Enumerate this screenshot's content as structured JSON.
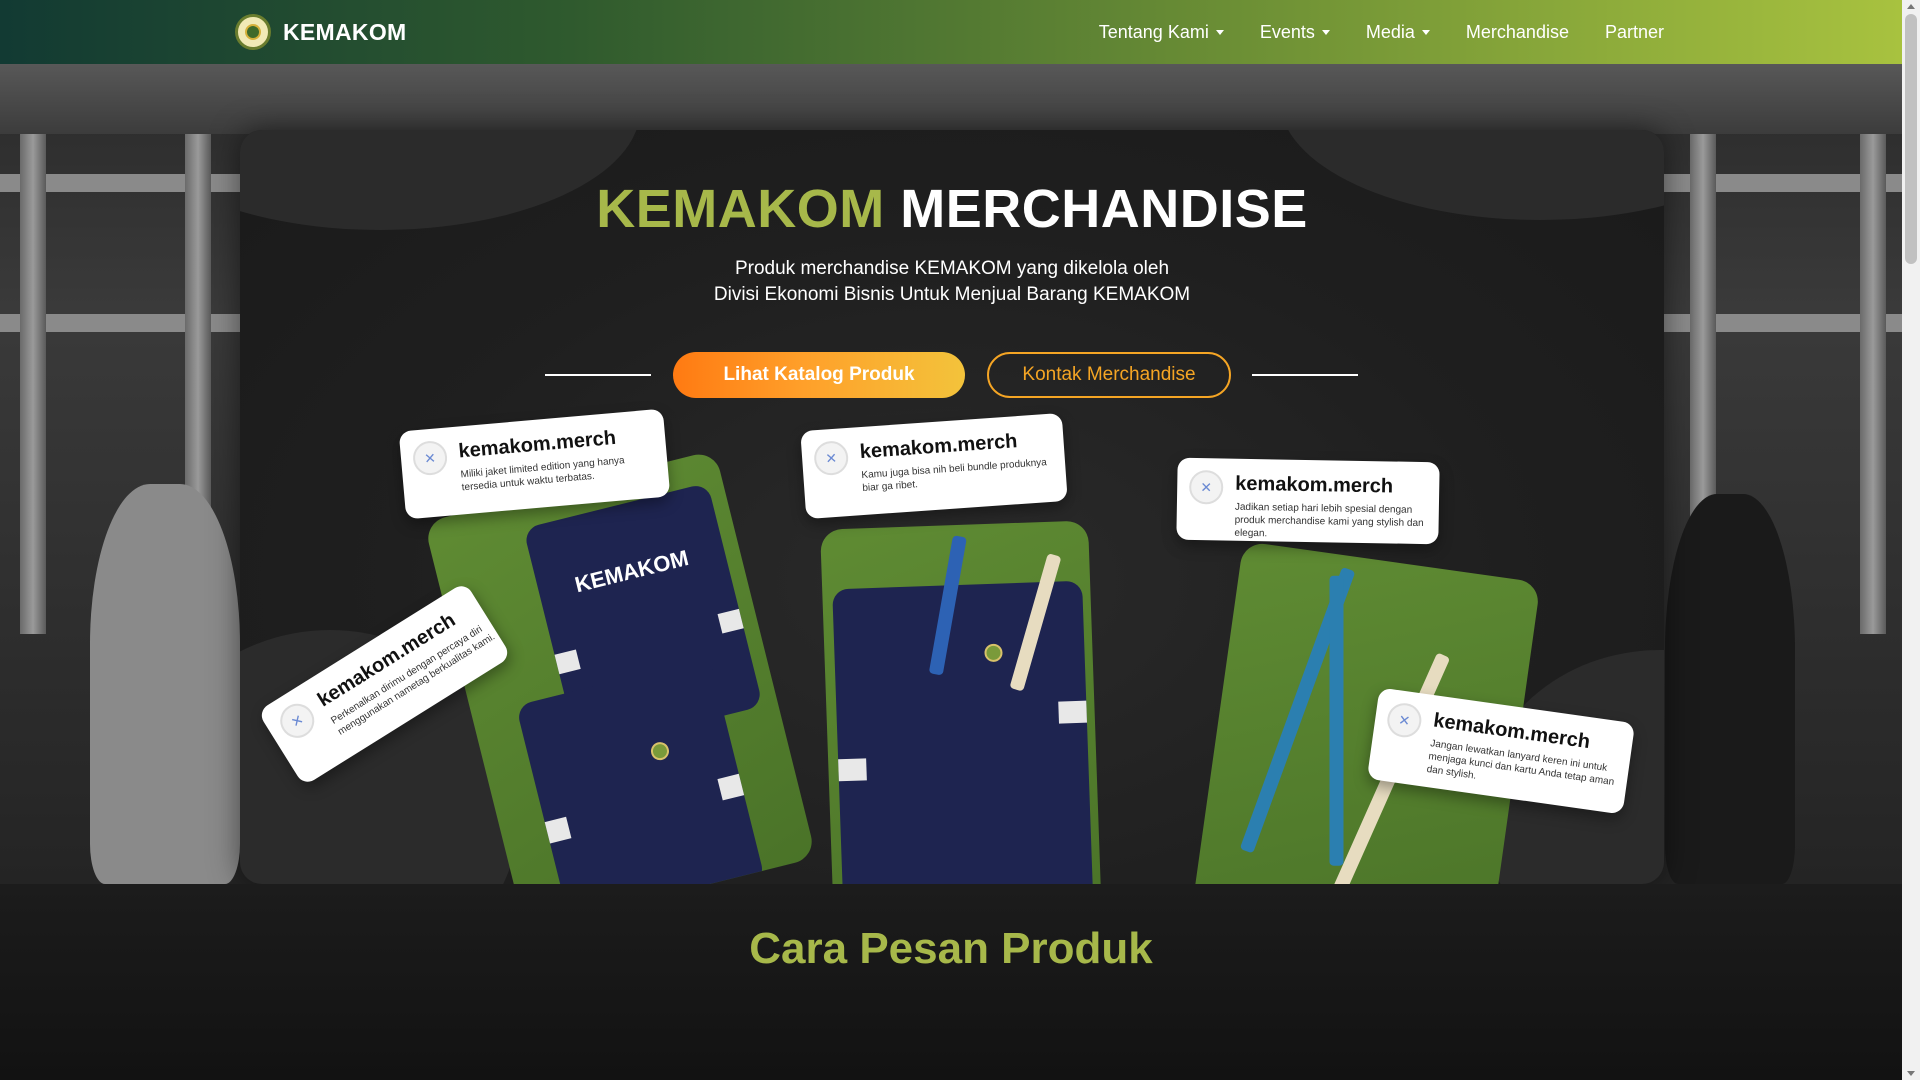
{
  "navbar": {
    "brand": "KEMAKOM",
    "items": [
      {
        "label": "Tentang Kami",
        "dropdown": true
      },
      {
        "label": "Events",
        "dropdown": true
      },
      {
        "label": "Media",
        "dropdown": true
      },
      {
        "label": "Merchandise",
        "dropdown": false
      },
      {
        "label": "Partner",
        "dropdown": false
      }
    ]
  },
  "hero": {
    "title_accent": "KEMAKOM",
    "title_rest": "MERCHANDISE",
    "subtitle_line1": "Produk merchandise KEMAKOM yang dikelola oleh",
    "subtitle_line2": "Divisi Ekonomi Bisnis Untuk Menjual Barang KEMAKOM",
    "primary_button": "Lihat Katalog Produk",
    "secondary_button": "Kontak Merchandise"
  },
  "products": {
    "handle": "kemakom.merch",
    "captions": [
      "Miliki jaket limited edition yang hanya tersedia untuk waktu terbatas.",
      "Perkenalkan dirimu dengan percaya diri menggunakan nametag berkualitas kami.",
      "Kamu juga bisa nih beli bundle produknya biar ga ribet.",
      "Jadikan setiap hari lebih spesial dengan produk merchandise kami yang stylish dan elegan.",
      "Jangan lewatkan lanyard keren ini untuk menjaga kunci dan kartu Anda tetap aman dan stylish."
    ],
    "jacket_print": "KEMAKOM"
  },
  "section": {
    "title": "Cara Pesan Produk"
  },
  "colors": {
    "accent_green": "#a7b84a",
    "button_orange": "#ff7a12",
    "outline_orange": "#f5a524"
  }
}
